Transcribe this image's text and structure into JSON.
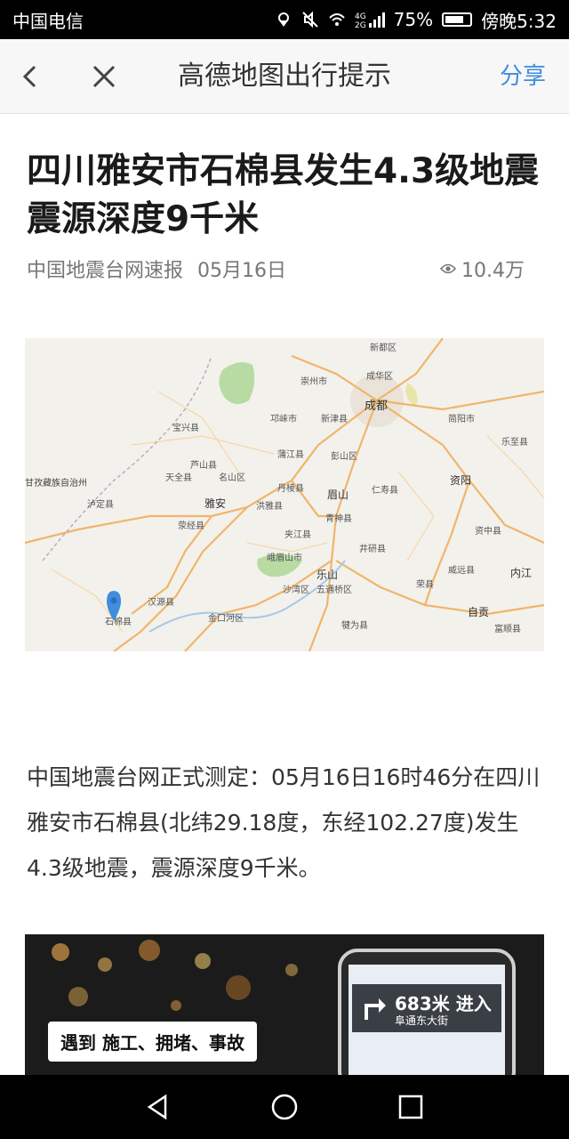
{
  "status_bar": {
    "carrier": "中国电信",
    "battery_percent": "75%",
    "battery_level": 0.75,
    "time": "傍晚5:32",
    "signal_label": "4G 2G"
  },
  "nav": {
    "title": "高德地图出行提示",
    "share_label": "分享",
    "back_icon": "chevron-left-icon",
    "close_icon": "close-icon"
  },
  "article": {
    "title": "四川雅安市石棉县发生4.3级地震 震源深度9千米",
    "source": "中国地震台网速报",
    "date": "05月16日",
    "views": "10.4万",
    "body": "中国地震台网正式测定：05月16日16时46分在四川雅安市石棉县(北纬29.18度，东经102.27度)发生4.3级地震，震源深度9千米。"
  },
  "map": {
    "labels": {
      "chengdu": "成都",
      "xindu": "新都区",
      "chenghua": "成华区",
      "chongzhou": "崇州市",
      "qionglai": "邛崃市",
      "xinjin": "新津县",
      "jianyang": "简阳市",
      "lezhi": "乐至县",
      "baoxing": "宝兴县",
      "lushan": "芦山县",
      "mingshan": "名山区",
      "tianquan": "天全县",
      "yaan": "雅安",
      "pujiang": "蒲江县",
      "pengshan": "彭山区",
      "danleng": "丹棱县",
      "hongya": "洪雅县",
      "meishan": "眉山",
      "renshou": "仁寿县",
      "ziyang": "资阳",
      "ganzi": "甘孜藏族自治州",
      "luding": "泸定县",
      "yingjing": "荥经县",
      "qingshen": "青神县",
      "jiajiang": "夹江县",
      "emeishan": "峨眉山市",
      "jingyan": "井研县",
      "ziyang_county": "资中县",
      "leshan": "乐山",
      "shawan": "沙湾区",
      "wutongqiao": "五通桥区",
      "rong": "荣县",
      "weiyuan": "威远县",
      "neijiang": "内江",
      "hanyuan": "汉源县",
      "shimian": "石棉县",
      "jinkouhe": "金口河区",
      "qianwei": "犍为县",
      "zigong": "自贡",
      "fushun": "富顺县"
    },
    "marker_icon": "location-pin-icon"
  },
  "ad": {
    "label": "遇到 施工、拥堵、事故",
    "distance": "683米 进入",
    "street": "阜通东大街"
  },
  "system_nav": {
    "back_icon": "triangle-back-icon",
    "home_icon": "circle-home-icon",
    "recent_icon": "square-recent-icon"
  }
}
